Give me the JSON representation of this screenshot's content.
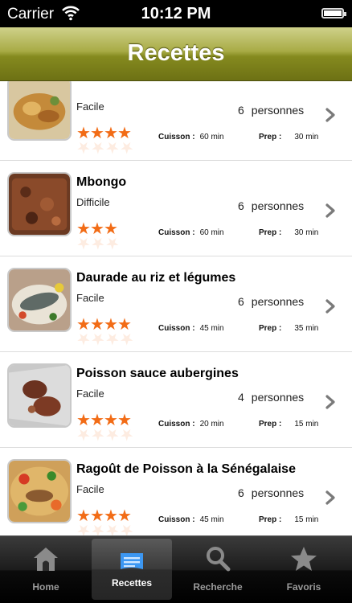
{
  "status_bar": {
    "carrier": "Carrier",
    "time": "10:12 PM"
  },
  "nav": {
    "title": "Recettes"
  },
  "labels": {
    "cuisson": "Cuisson :",
    "prep": "Prep :",
    "persons_unit": "personnes"
  },
  "recipes": [
    {
      "name": "",
      "difficulty": "Facile",
      "persons": "6",
      "stars": 4,
      "cuisson": "60 min",
      "prep": "30 min",
      "photo": "golden-fried-dish"
    },
    {
      "name": "Mbongo",
      "difficulty": "Difficile",
      "persons": "6",
      "stars": 3,
      "cuisson": "60 min",
      "prep": "30 min",
      "photo": "dark-brown-stew"
    },
    {
      "name": "Daurade au riz et légumes",
      "difficulty": "Facile",
      "persons": "6",
      "stars": 4,
      "cuisson": "45 min",
      "prep": "35 min",
      "photo": "fish-on-rice"
    },
    {
      "name": "Poisson sauce aubergines",
      "difficulty": "Facile",
      "persons": "4",
      "stars": 4,
      "cuisson": "20 min",
      "prep": "15 min",
      "photo": "fish-in-foil"
    },
    {
      "name": "Ragoût de Poisson à la Sénégalaise",
      "difficulty": "Facile",
      "persons": "6",
      "stars": 4,
      "cuisson": "45 min",
      "prep": "15 min",
      "photo": "colorful-fish-stew"
    }
  ],
  "tabs": [
    {
      "label": "Home",
      "icon": "home-icon",
      "active": false
    },
    {
      "label": "Recettes",
      "icon": "recipes-icon",
      "active": true
    },
    {
      "label": "Recherche",
      "icon": "search-icon",
      "active": false
    },
    {
      "label": "Favoris",
      "icon": "star-icon",
      "active": false
    }
  ],
  "colors": {
    "nav_olive": "#858a1f",
    "star_orange": "#f26c16",
    "tab_active_icon": "#4aa3ff"
  }
}
